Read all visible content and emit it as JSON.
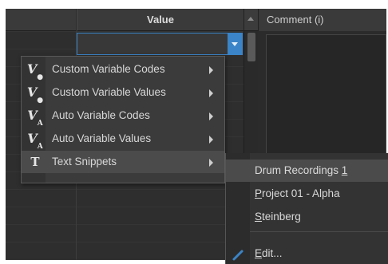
{
  "table": {
    "value_header": "Value",
    "comment_header": "Comment (i)"
  },
  "colors": {
    "accent": "#3b84c7",
    "menu_bg": "#3b3b3b",
    "highlight": "#4b4b4b"
  },
  "menu": {
    "items": [
      {
        "icon": "variable-user-icon",
        "icon_text": "V",
        "label": "Custom Variable Codes",
        "has_submenu": true
      },
      {
        "icon": "variable-user-icon",
        "icon_text": "V",
        "label": "Custom Variable Values",
        "has_submenu": true
      },
      {
        "icon": "variable-auto-icon",
        "icon_text": "V",
        "label": "Auto Variable Codes",
        "has_submenu": true
      },
      {
        "icon": "variable-auto-icon",
        "icon_text": "V",
        "label": "Auto Variable Values",
        "has_submenu": true
      },
      {
        "icon": "text-snippet-icon",
        "icon_text": "T",
        "label": "Text Snippets",
        "has_submenu": true,
        "active": true
      }
    ]
  },
  "submenu": {
    "items": [
      {
        "label_pre": "Drum Recordings ",
        "label_u": "1",
        "label_post": "",
        "active": true
      },
      {
        "label_pre": "",
        "label_u": "P",
        "label_post": "roject 01 - Alpha"
      },
      {
        "label_pre": "",
        "label_u": "S",
        "label_post": "teinberg"
      }
    ],
    "edit": {
      "label_pre": "",
      "label_u": "E",
      "label_post": "dit...",
      "icon": "pencil-icon"
    }
  }
}
